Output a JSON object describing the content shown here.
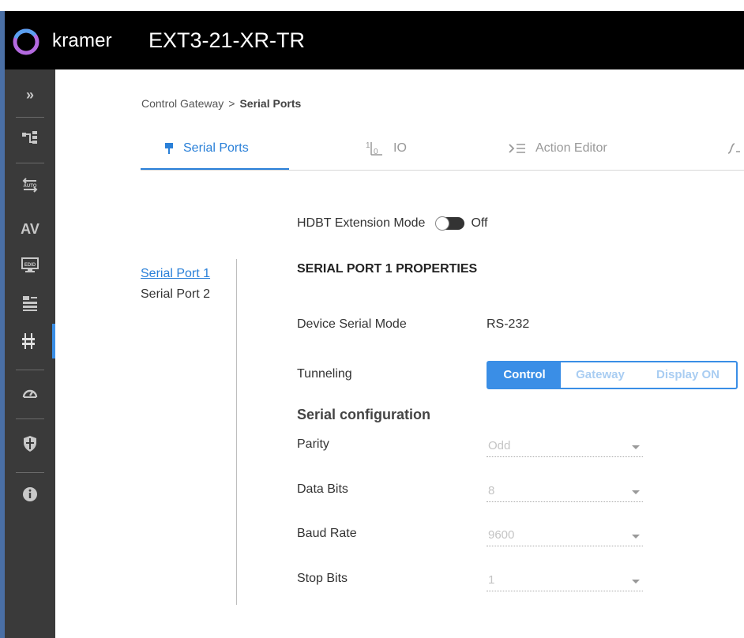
{
  "header": {
    "brand": "kramer",
    "device": "EXT3-21-XR-TR"
  },
  "sidebar": {
    "items": [
      {
        "icon": "expand-icon",
        "glyph": "»"
      },
      {
        "icon": "routing-icon",
        "glyph": ""
      },
      {
        "icon": "auto-switch-icon",
        "glyph": ""
      },
      {
        "icon": "av-icon",
        "glyph": "AV"
      },
      {
        "icon": "edid-icon",
        "glyph": ""
      },
      {
        "icon": "settings-icon",
        "glyph": ""
      },
      {
        "icon": "control-gateway-icon",
        "glyph": "",
        "active": true
      },
      {
        "icon": "diagnostics-icon",
        "glyph": ""
      },
      {
        "icon": "security-icon",
        "glyph": ""
      },
      {
        "icon": "info-icon",
        "glyph": ""
      }
    ]
  },
  "breadcrumb": {
    "parent": "Control Gateway",
    "separator": ">",
    "current": "Serial Ports"
  },
  "tabs": [
    {
      "label": "Serial Ports",
      "icon": "serial-port-icon",
      "active": true
    },
    {
      "label": "IO",
      "icon": "io-icon"
    },
    {
      "label": "Action Editor",
      "icon": "action-editor-icon"
    }
  ],
  "hdbt": {
    "label": "HDBT Extension Mode",
    "state": "Off"
  },
  "ports": [
    {
      "label": "Serial Port 1",
      "active": true
    },
    {
      "label": "Serial Port 2"
    }
  ],
  "properties": {
    "title": "SERIAL PORT 1 PROPERTIES",
    "device_serial_mode_label": "Device Serial Mode",
    "device_serial_mode_value": "RS-232",
    "tunneling_label": "Tunneling",
    "tunneling_options": [
      "Control",
      "Gateway",
      "Display ON"
    ],
    "tunneling_selected": "Control"
  },
  "serial_config": {
    "title": "Serial configuration",
    "parity": {
      "label": "Parity",
      "value": "Odd"
    },
    "data_bits": {
      "label": "Data Bits",
      "value": "8"
    },
    "baud_rate": {
      "label": "Baud Rate",
      "value": "9600"
    },
    "stop_bits": {
      "label": "Stop Bits",
      "value": "1"
    }
  },
  "colors": {
    "accent": "#3a8ee6",
    "topbar": "#000000",
    "sidebar": "#3a3a3a"
  }
}
